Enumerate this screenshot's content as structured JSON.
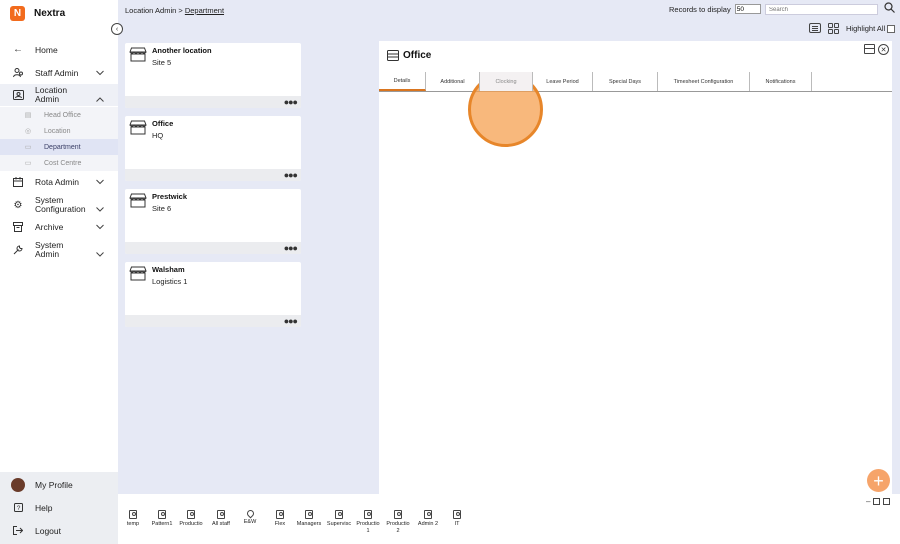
{
  "brand": {
    "name": "Nextra",
    "logo_letter": "N"
  },
  "sidebar": {
    "items": [
      {
        "label": "Home",
        "icon": "arrow-left-icon"
      },
      {
        "label": "Staff Admin",
        "icon": "users-icon"
      },
      {
        "label": "Location\nAdmin",
        "icon": "id-card-icon"
      },
      {
        "label": "Rota Admin",
        "icon": "calendar-icon"
      },
      {
        "label": "System\nConfiguration",
        "icon": "gear-icon"
      },
      {
        "label": "Archive",
        "icon": "archive-icon"
      },
      {
        "label": "System\nAdmin",
        "icon": "wrench-icon"
      }
    ],
    "sub_items": [
      {
        "label": "Head Office",
        "icon": "building-icon"
      },
      {
        "label": "Location",
        "icon": "pin-icon"
      },
      {
        "label": "Department",
        "icon": "department-icon"
      },
      {
        "label": "Cost Centre",
        "icon": "cost-centre-icon"
      }
    ],
    "bottom": [
      {
        "label": "My Profile",
        "icon": "avatar"
      },
      {
        "label": "Help",
        "icon": "help-icon"
      },
      {
        "label": "Logout",
        "icon": "logout-icon"
      }
    ]
  },
  "breadcrumb": {
    "prefix": "Location Admin > ",
    "current": "Department"
  },
  "toolbar": {
    "records_label": "Records to display",
    "records_value": "50",
    "search_placeholder": "Search",
    "highlight_label": "Highlight All"
  },
  "cards": [
    {
      "title": "Another location",
      "subtitle": "Site 5"
    },
    {
      "title": "Office",
      "subtitle": "HQ"
    },
    {
      "title": "Prestwick",
      "subtitle": "Site 6"
    },
    {
      "title": "Walsham",
      "subtitle": "Logistics 1"
    }
  ],
  "panel": {
    "title": "Office",
    "tabs": [
      "Details",
      "Additional",
      "Clocking",
      "Leave Period",
      "Special Days",
      "Timesheet Configuration",
      "Notifications"
    ],
    "active_tab": "Details"
  },
  "footer": {
    "staff": [
      "temp",
      "Pattern1",
      "Productio",
      "All staff",
      "E&W",
      "Flex",
      "Managers",
      "Supervisc",
      "Productio\n1",
      "Productio\n2",
      "Admin 2",
      "IT"
    ]
  },
  "colors": {
    "accent": "#f26b1d",
    "tab_underline": "#d9751f",
    "background": "#e6e9f5"
  }
}
